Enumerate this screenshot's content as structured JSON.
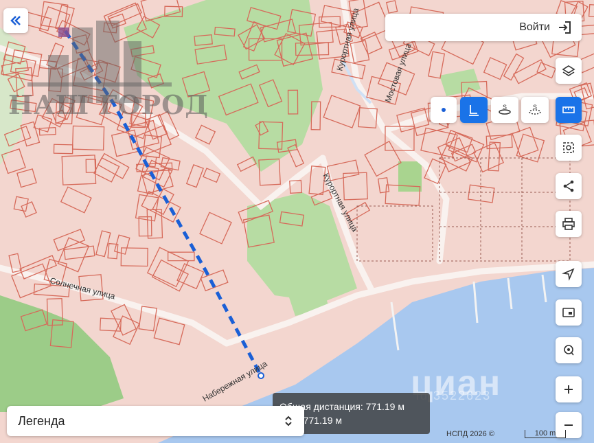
{
  "nav": {
    "back_icon": "double-chevron-left-icon"
  },
  "header": {
    "login_label": "Войти",
    "login_icon": "sign-in-icon"
  },
  "logo": {
    "text": "НАШ ГОРОД"
  },
  "streets": {
    "solnechnaya": "Солнечная улица",
    "naberezhnaya": "Набережная улица",
    "kurortnaya_upper": "Курортная улица",
    "kurortnaya_mid": "Курортная улица",
    "mostovaya": "Мостовая улица"
  },
  "measure": {
    "total_distance": "Общая дистанция: 771.19 м",
    "area": "щая: 771.19 м"
  },
  "legend": {
    "label": "Легенда",
    "icon": "updown-chevron-icon"
  },
  "attribution": "НСПД 2026 ©",
  "scale": {
    "label": "100 m",
    "meters": 100
  },
  "watermark": {
    "brand": "циан",
    "id": "id 3522623"
  },
  "tools": {
    "point": "point-icon",
    "line": "line-measure-icon",
    "area_s": "area-s-icon",
    "area_s2": "area-s-outline-icon",
    "ruler": "ruler-icon",
    "layers": "layers-icon",
    "select": "select-area-icon",
    "share": "share-icon",
    "print": "print-icon",
    "locate": "navigate-icon",
    "frame": "frame-icon",
    "search": "geo-search-icon",
    "zoom_in": "plus-icon",
    "zoom_out": "minus-icon"
  },
  "colors": {
    "parcel_fill": "#f3d6cf",
    "parcel_stroke": "#d66a5a",
    "green": "#b7dca3",
    "water": "#a8c8ef",
    "road": "#f9f2ef",
    "measure_line": "#1a5fd6",
    "accent": "#1a73e8"
  }
}
